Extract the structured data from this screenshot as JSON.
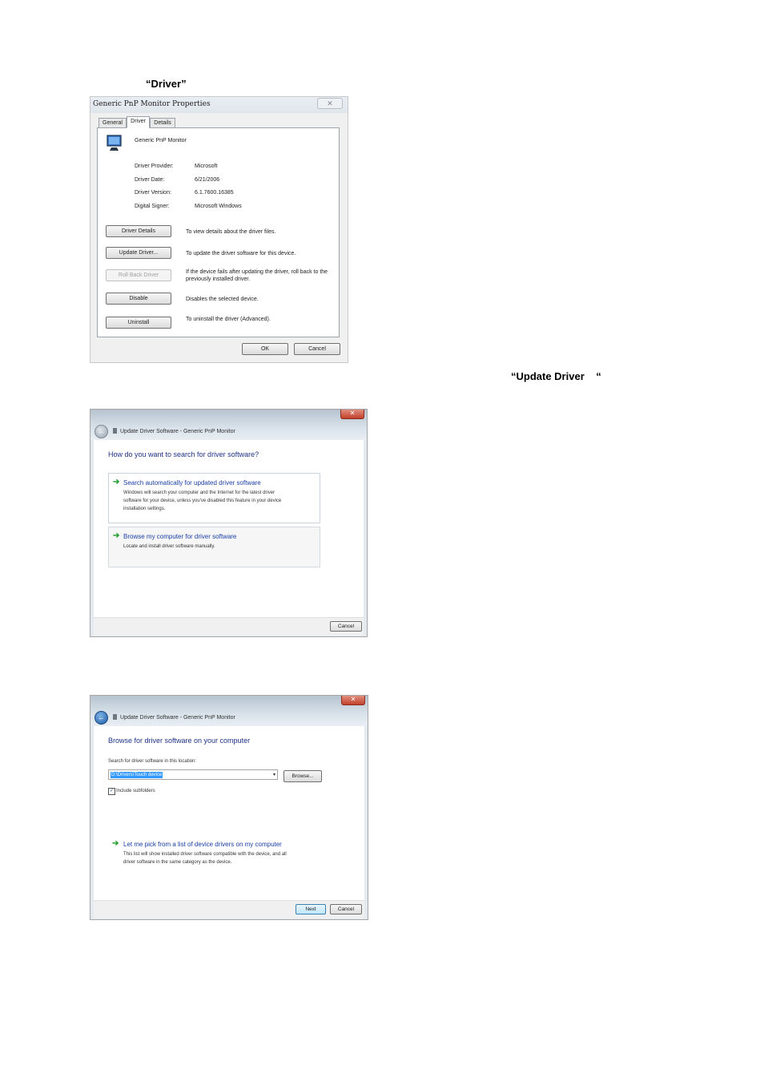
{
  "captions": {
    "driver": "“Driver”",
    "update_driver": "“Update Driver    “"
  },
  "properties_dialog": {
    "title": "Generic PnP Monitor Properties",
    "close_glyph": "✕",
    "tabs": [
      "General",
      "Driver",
      "Details"
    ],
    "active_tab": "Driver",
    "device_name": "Generic PnP Monitor",
    "info": [
      {
        "label": "Driver Provider:",
        "value": "Microsoft"
      },
      {
        "label": "Driver Date:",
        "value": "6/21/2006"
      },
      {
        "label": "Driver Version:",
        "value": "6.1.7600.16385"
      },
      {
        "label": "Digital Signer:",
        "value": "Microsoft Windows"
      }
    ],
    "actions": [
      {
        "button": "Driver Details",
        "description": "To view details about the driver files.",
        "enabled": true
      },
      {
        "button": "Update Driver...",
        "description": "To update the driver software for this device.",
        "enabled": true
      },
      {
        "button": "Roll Back Driver",
        "description": "If the device fails after updating the driver, roll back to the previously installed driver.",
        "enabled": false
      },
      {
        "button": "Disable",
        "description": "Disables the selected device.",
        "enabled": true
      },
      {
        "button": "Uninstall",
        "description": "To uninstall the driver (Advanced).",
        "enabled": true
      }
    ],
    "ok_label": "OK",
    "cancel_label": "Cancel"
  },
  "wizard_search": {
    "title": "Update Driver Software - Generic PnP Monitor",
    "close_glyph": "✕",
    "back_glyph": "←",
    "heading": "How do you want to search for driver software?",
    "options": [
      {
        "title": "Search automatically for updated driver software",
        "description": [
          "Windows will search your computer and the Internet for the latest driver",
          "software for your device, unless you've disabled this feature in your device",
          "installation settings."
        ]
      },
      {
        "title": "Browse my computer for driver software",
        "description": [
          "Locate and install driver software manually."
        ]
      }
    ],
    "arrow_glyph": "➔",
    "cancel_label": "Cancel"
  },
  "wizard_browse": {
    "title": "Update Driver Software - Generic PnP Monitor",
    "close_glyph": "✕",
    "back_glyph": "←",
    "heading": "Browse for driver software on your computer",
    "location_label": "Search for driver software in this location:",
    "path_value": "D:\\Drivers\\Touch device",
    "dropdown_glyph": "▾",
    "browse_label": "Browse...",
    "include_subfolders_label": "Include subfolders",
    "include_subfolders_checked": true,
    "check_glyph": "✓",
    "pick_title": "Let me pick from a list of device drivers on my computer",
    "pick_description": [
      "This list will show installed driver software compatible with the device, and all",
      "driver software in the same category as the device."
    ],
    "arrow_glyph": "➔",
    "next_label": "Next",
    "cancel_label": "Cancel"
  }
}
